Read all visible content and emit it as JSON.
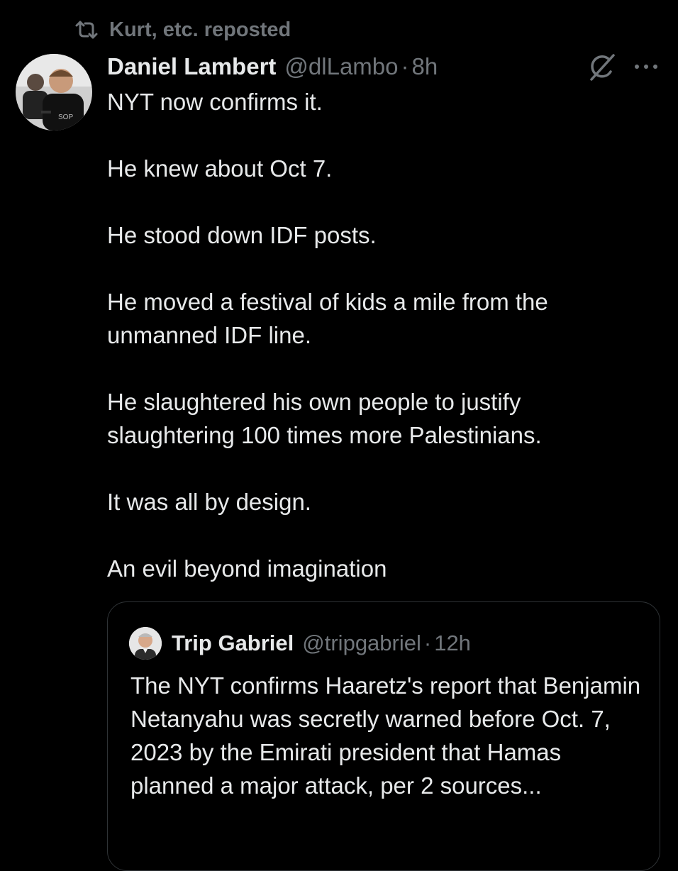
{
  "repost": {
    "label": "Kurt, etc. reposted",
    "icon": "repost-icon"
  },
  "tweet": {
    "author_name": "Daniel Lambert",
    "author_handle": "@dlLambo",
    "separator": "·",
    "time": "8h",
    "paragraphs": [
      "NYT now confirms it.",
      "He knew about Oct 7.",
      "He stood down IDF posts.",
      "He moved a festival of kids a mile from the unmanned IDF line.",
      "He slaughtered his own people to justify slaughtering 100 times more Palestinians.",
      "It was all by design.",
      "An evil beyond imagination"
    ]
  },
  "quote": {
    "author_name": "Trip Gabriel",
    "author_handle": "@tripgabriel",
    "separator": "·",
    "time": "12h",
    "text": "The NYT confirms Haaretz's report that Benjamin Netanyahu was secretly warned before Oct. 7,  2023 by the Emirati president that Hamas planned a major attack, per 2 sources..."
  },
  "icons": {
    "repost": "repost-icon",
    "grok": "grok-icon",
    "more": "more-icon"
  },
  "colors": {
    "background": "#000000",
    "text_primary": "#e7e9ea",
    "text_secondary": "#71767b",
    "border": "#2f3336"
  }
}
